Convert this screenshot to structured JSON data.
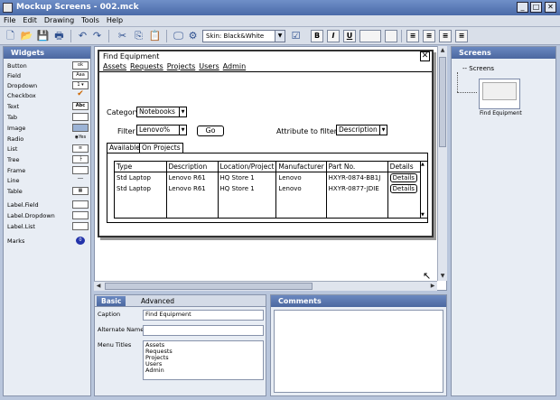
{
  "window": {
    "title": "Mockup Screens - 002.mck",
    "min": "_",
    "max": "□",
    "close": "✕"
  },
  "menubar": [
    "File",
    "Edit",
    "Drawing",
    "Tools",
    "Help"
  ],
  "toolbar": {
    "skin": "Skin: Black&White",
    "bold": "B",
    "italic": "I",
    "underline": "U"
  },
  "widgets": {
    "title": "Widgets",
    "items": [
      {
        "label": "Button",
        "icon": "ok"
      },
      {
        "label": "Field",
        "icon": "Aaa"
      },
      {
        "label": "Dropdown",
        "icon": "1 ▾"
      },
      {
        "label": "Checkbox",
        "icon": "✔"
      },
      {
        "label": "Text",
        "icon": "Abc"
      },
      {
        "label": "Tab",
        "icon": ""
      },
      {
        "label": "Image",
        "icon": ""
      },
      {
        "label": "Radio",
        "icon": "◉Yes"
      },
      {
        "label": "List",
        "icon": ""
      },
      {
        "label": "Tree",
        "icon": ""
      },
      {
        "label": "Frame",
        "icon": ""
      },
      {
        "label": "Line",
        "icon": ""
      },
      {
        "label": "Table",
        "icon": ""
      },
      {
        "label": "Label.Field",
        "icon": ""
      },
      {
        "label": "Label.Dropdown",
        "icon": ""
      },
      {
        "label": "Label.List",
        "icon": ""
      },
      {
        "label": "Marks",
        "icon": "0"
      }
    ]
  },
  "mockup": {
    "title": "Find Equipment",
    "menu": [
      "Assets",
      "Requests",
      "Projects",
      "Users",
      "Admin"
    ],
    "category_label": "Category",
    "category_value": "Notebooks",
    "filter_label": "Filter",
    "filter_value": "Lenovo%",
    "go_label": "Go",
    "attr_label": "Attribute to filter",
    "attr_value": "Description",
    "tabs": [
      "Available",
      "On Projects"
    ],
    "columns": [
      "Type",
      "Description",
      "Location/Project",
      "Manufacturer",
      "Part No.",
      "Details"
    ],
    "rows": [
      [
        "Std Laptop",
        "Lenovo R61",
        "HQ Store 1",
        "Lenovo",
        "HXYR-0874-BB1J",
        "Details"
      ],
      [
        "Std Laptop",
        "Lenovo R61",
        "HQ Store 1",
        "Lenovo",
        "HXYR-0877-JDIE",
        "Details"
      ]
    ]
  },
  "screens": {
    "title": "Screens",
    "root": "Screens",
    "thumb_label": "Find Equipment"
  },
  "props": {
    "tabs": [
      "Basic",
      "Advanced"
    ],
    "caption_label": "Caption",
    "caption_value": "Find Equipment",
    "alt_label": "Alternate Name",
    "alt_value": "",
    "menu_titles_label": "Menu Titles",
    "menu_titles": [
      "Assets",
      "Requests",
      "Projects",
      "Users",
      "Admin"
    ]
  },
  "comments": {
    "title": "Comments"
  }
}
